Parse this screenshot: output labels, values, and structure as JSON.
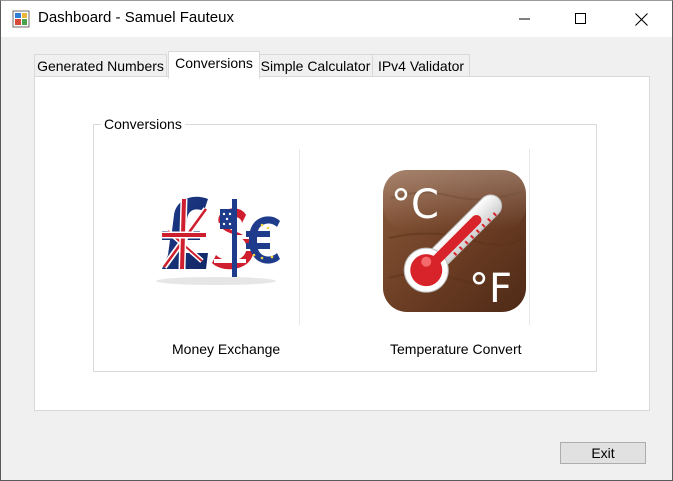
{
  "window": {
    "title": "Dashboard - Samuel Fauteux"
  },
  "icons": {
    "app": "app-window-icon",
    "minimize": "minimize-icon",
    "maximize": "maximize-icon",
    "close": "close-icon"
  },
  "tabs": [
    {
      "label": "Generated Numbers",
      "selected": false
    },
    {
      "label": "Conversions",
      "selected": true
    },
    {
      "label": "Simple Calculator",
      "selected": false
    },
    {
      "label": "IPv4 Validator",
      "selected": false
    }
  ],
  "conversions": {
    "group_title": "Conversions",
    "items": [
      {
        "label": "Money Exchange",
        "image": "currency-symbols-image"
      },
      {
        "label": "Temperature Convert",
        "image": "thermometer-celsius-fahrenheit-image"
      }
    ],
    "temp_image_text": {
      "celsius": "°C",
      "fahrenheit": "°F"
    }
  },
  "footer": {
    "exit_label": "Exit"
  },
  "colors": {
    "tab_border": "#d9d9d9",
    "panel_bg": "#ffffff",
    "window_bg": "#f0f0f0",
    "button_bg": "#e1e1e1"
  }
}
